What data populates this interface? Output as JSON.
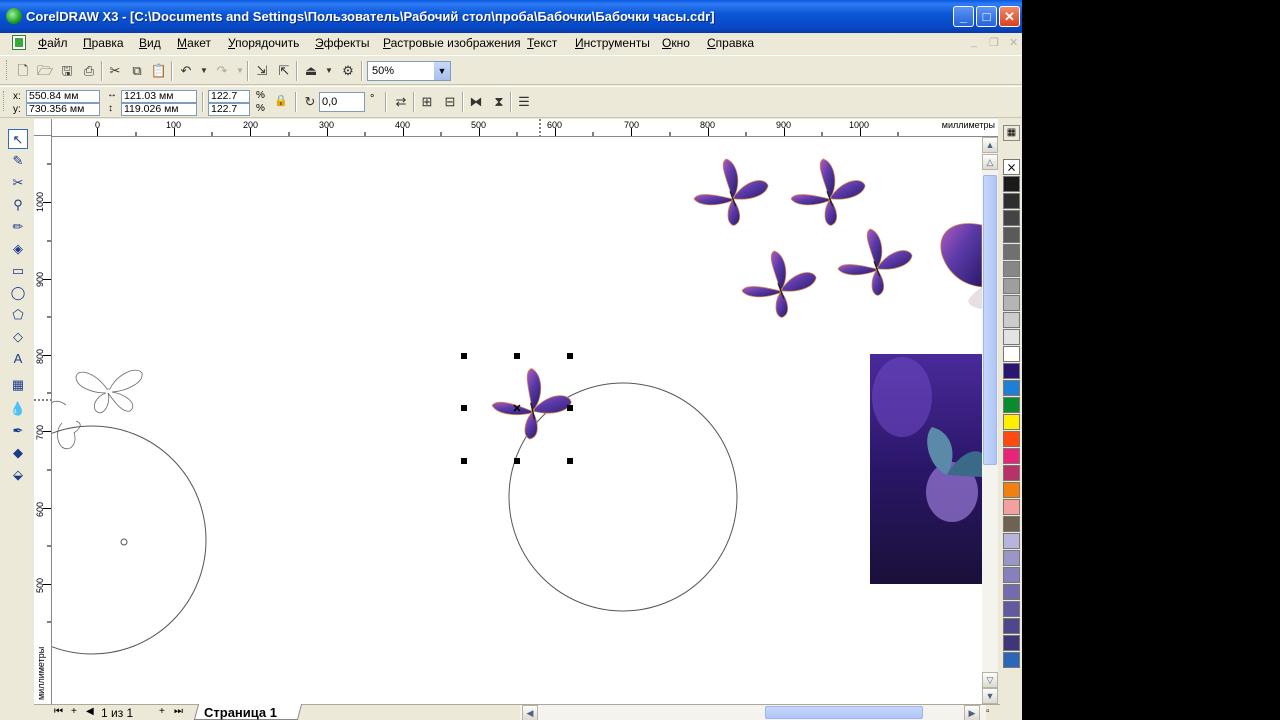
{
  "window": {
    "title": "CorelDRAW X3 - [C:\\Documents and Settings\\Пользователь\\Рабочий стол\\проба\\Бабочки\\Бабочки часы.cdr]",
    "minimize": "_",
    "maximize": "□",
    "close": "✕"
  },
  "menu": {
    "items": [
      "Файл",
      "Правка",
      "Вид",
      "Макет",
      "Упорядочить",
      "Эффекты",
      "Растровые изображения",
      "Текст",
      "Инструменты",
      "Окно",
      "Справка"
    ]
  },
  "toolbar": {
    "zoom_value": "50%"
  },
  "property_bar": {
    "x_label": "x:",
    "y_label": "y:",
    "x_value": "550.84 мм",
    "y_value": "730.356 мм",
    "width_value": "121.03 мм",
    "height_value": "119.026 мм",
    "scale_x": "122.7",
    "scale_y": "122.7",
    "percent": "%",
    "rotation": "0,0",
    "degree": "°"
  },
  "rulers": {
    "units": "миллиметры",
    "h_labels": [
      "0",
      "100",
      "200",
      "300",
      "400",
      "500",
      "600",
      "700",
      "800",
      "900",
      "1000"
    ],
    "v_labels": [
      "1000",
      "900",
      "800",
      "700",
      "600",
      "500"
    ]
  },
  "palette": {
    "colors": [
      "#1a1a1a",
      "#2e2e2e",
      "#444444",
      "#5a5a5a",
      "#707070",
      "#878787",
      "#9e9e9e",
      "#b5b5b5",
      "#cccccc",
      "#e3e3e3",
      "#ffffff",
      "#2a1670",
      "#1e7fd6",
      "#0b8a2e",
      "#ffee00",
      "#ff4a10",
      "#e8237a",
      "#b8326a",
      "#f08010",
      "#f5a0a0",
      "#6e6252",
      "#b8b4dc",
      "#9a96c8",
      "#8680bc",
      "#746aae",
      "#625a9e",
      "#50468c",
      "#3e3678",
      "#2c66b8"
    ]
  },
  "status": {
    "page_counter": "1 из 1",
    "page_tab": "Страница 1"
  }
}
